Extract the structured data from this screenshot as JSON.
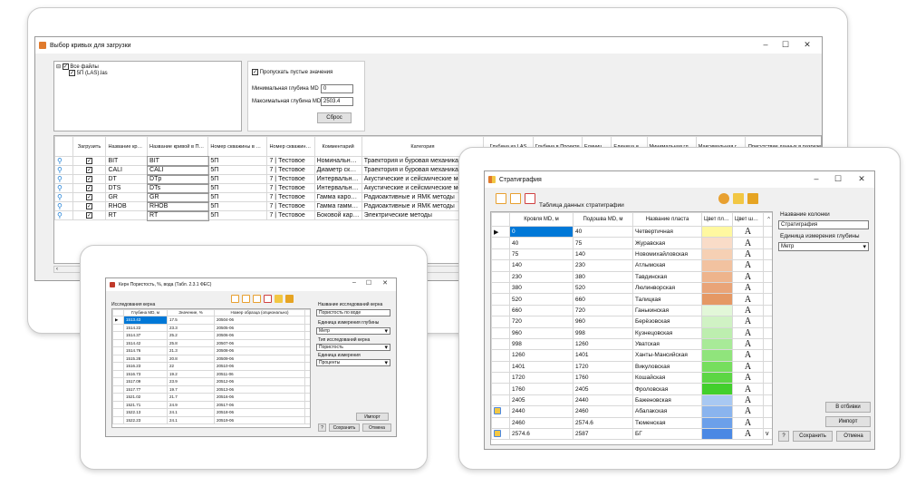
{
  "main": {
    "title": "Выбор кривых для загрузки",
    "tree_root": "Все файлы",
    "tree_child": "5П (LAS).las",
    "skip_empty_label": "Пропускать пустые значения",
    "min_depth_label": "Минимальная глубина MD",
    "min_depth_value": "0",
    "max_depth_label": "Максимальная глубина MD",
    "max_depth_value": "2503.4",
    "reset_label": "Сброс",
    "columns": [
      "Загрузить",
      "Название кривой из LAS",
      "Название кривой в Проекте",
      "Номер скважины в файле",
      "Номер скважины в Проекте",
      "Комментарий",
      "Категория",
      "Глубина из LAS",
      "Глубина в Проекте",
      "Единица измерения из LAS",
      "Единица измерения в Проекте",
      "Минимальная глубина MD",
      "Максимальная глубина MD",
      "Присутствие данных в разрезе"
    ],
    "rows": [
      [
        "BIT",
        "BIT",
        "5П",
        "7 | Тестовое",
        "Номинальный д...",
        "Траектория и буровая механика",
        "М"
      ],
      [
        "CALI",
        "CALI",
        "5П",
        "7 | Тестовое",
        "Диаметр скваж...",
        "Траектория и буровая механика",
        "М"
      ],
      [
        "DT",
        "DTp",
        "5П",
        "7 | Тестовое",
        "Интервальное в...",
        "Акустические и сейсмические методы",
        "М"
      ],
      [
        "DTS",
        "DTs",
        "5П",
        "7 | Тестовое",
        "Интервальное в...",
        "Акустические и сейсмические методы",
        "М"
      ],
      [
        "GR",
        "GR",
        "5П",
        "7 | Тестовое",
        "Гамма каротаж",
        "Радиоактивные и ЯМК методы",
        "М"
      ],
      [
        "RHOB",
        "RHOB",
        "5П",
        "7 | Тестовое",
        "Гамма гамма пл...",
        "Радиоактивные и ЯМК методы",
        "М"
      ],
      [
        "RT",
        "RT",
        "5П",
        "7 | Тестовое",
        "Боковой каротаж",
        "Электрические методы",
        "М"
      ]
    ]
  },
  "core": {
    "title": "Керн Пористость, %, вода (Табл. 2.3.1 ФЕС)",
    "section_label": "Исследования керна",
    "columns": [
      "Глубина MD, м",
      "Значение, %",
      "Номер образца (опционально)"
    ],
    "rows": [
      [
        "1513.43",
        "17.5",
        "20504-06"
      ],
      [
        "1514.22",
        "23.3",
        "20505-06"
      ],
      [
        "1514.37",
        "25.2",
        "20506-06"
      ],
      [
        "1514.42",
        "25.8",
        "20507-06"
      ],
      [
        "1514.76",
        "21.3",
        "20508-06"
      ],
      [
        "1515.28",
        "20.8",
        "20509-06"
      ],
      [
        "1516.23",
        "22",
        "20510-06"
      ],
      [
        "1516.73",
        "19.2",
        "20511-06"
      ],
      [
        "1517.09",
        "23.9",
        "20512-06"
      ],
      [
        "1517.77",
        "19.7",
        "20513-06"
      ],
      [
        "1521.02",
        "21.7",
        "20516-06"
      ],
      [
        "1521.71",
        "24.9",
        "20517-06"
      ],
      [
        "1522.13",
        "24.1",
        "20518-06"
      ],
      [
        "1522.23",
        "24.1",
        "20519-06"
      ]
    ],
    "name_label": "Название исследований керна",
    "name_value": "Пористость по воде",
    "depth_unit_label": "Единица измерения глубины",
    "depth_unit_value": "Метр",
    "type_label": "Тип исследований керна",
    "type_value": "Пористость",
    "unit_label": "Единица измерения",
    "unit_value": "Проценты",
    "import_label": "Импорт",
    "help_label": "?",
    "save_label": "Сохранить",
    "cancel_label": "Отмена"
  },
  "strat": {
    "title": "Стратиграфия",
    "table_label": "Таблица данных стратиграфии",
    "columns": [
      "Кровля MD, м",
      "Подошва MD, м",
      "Название пласта",
      "Цвет пласта",
      "Цвет шрифта"
    ],
    "rows": [
      [
        "0",
        "40",
        "Четвертичная",
        "#fff8a0"
      ],
      [
        "40",
        "75",
        "Журавская",
        "#f9dcc8"
      ],
      [
        "75",
        "140",
        "Новомихайловская",
        "#f6d0b4"
      ],
      [
        "140",
        "230",
        "Атлымская",
        "#f2c2a0"
      ],
      [
        "230",
        "380",
        "Тавдинская",
        "#eeb48c"
      ],
      [
        "380",
        "520",
        "Люлинворская",
        "#e9a478"
      ],
      [
        "520",
        "660",
        "Талицкая",
        "#e59864"
      ],
      [
        "660",
        "720",
        "Ганькинская",
        "#e2f7d8"
      ],
      [
        "720",
        "960",
        "Берёзовская",
        "#d0f2c4"
      ],
      [
        "960",
        "998",
        "Кузнецовская",
        "#bdeeaf"
      ],
      [
        "998",
        "1260",
        "Уватская",
        "#a8ea98"
      ],
      [
        "1260",
        "1401",
        "Ханты-Мансийская",
        "#90e47c"
      ],
      [
        "1401",
        "1720",
        "Викуловская",
        "#76de5e"
      ],
      [
        "1720",
        "1760",
        "Кошайская",
        "#5cd644"
      ],
      [
        "1760",
        "2405",
        "Фроловская",
        "#42cf2c"
      ],
      [
        "2405",
        "2440",
        "Баженовская",
        "#a8c8f2"
      ],
      [
        "2440",
        "2460",
        "Абалакская",
        "#8ab4ee"
      ],
      [
        "2460",
        "2574.6",
        "Тюменская",
        "#6ca0ea"
      ],
      [
        "2574.6",
        "2587",
        "БГ",
        "#4a88e4"
      ]
    ],
    "font_glyph": "A",
    "column_name_label": "Название колонки",
    "column_name_value": "Стратиграфия",
    "unit_label": "Единица измерения глубины",
    "unit_value": "Метр",
    "to_logs_label": "В отбивки",
    "import_label": "Импорт",
    "help_label": "?",
    "save_label": "Сохранить",
    "cancel_label": "Отмена"
  }
}
